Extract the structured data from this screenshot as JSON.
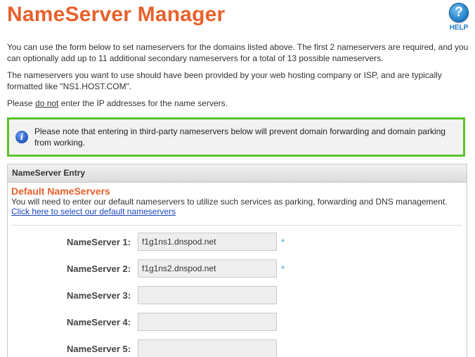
{
  "header": {
    "title": "NameServer Manager",
    "help_label": "HELP",
    "help_icon": "question-mark-icon"
  },
  "intro": {
    "paragraph1": "You can use the form below to set nameservers for the domains listed above. The first 2 nameservers are required, and you can optionally add up to 11 additional secondary nameservers for a total of 13 possible nameservers.",
    "paragraph2": "The nameservers you want to use should have been provided by your web hosting company or ISP, and are typically formatted like \"NS1.HOST.COM\".",
    "paragraph3_before": "Please ",
    "paragraph3_emphasis": "do not",
    "paragraph3_after": " enter the IP addresses for the name servers."
  },
  "notice": {
    "icon": "info-icon",
    "text": "Please note that entering in third-party nameservers below will prevent domain forwarding and domain parking from working."
  },
  "panel": {
    "header": "NameServer Entry",
    "section_title": "Default NameServers",
    "section_desc": "You will need to enter our default nameservers to utilize such services as parking, forwarding and DNS management.",
    "section_link": "Click here to select our default nameservers"
  },
  "nameservers": [
    {
      "label": "NameServer 1:",
      "value": "f1g1ns1.dnspod.net",
      "required_mark": "*"
    },
    {
      "label": "NameServer 2:",
      "value": "f1g1ns2.dnspod.net",
      "required_mark": "*"
    },
    {
      "label": "NameServer 3:",
      "value": "",
      "required_mark": ""
    },
    {
      "label": "NameServer 4:",
      "value": "",
      "required_mark": ""
    },
    {
      "label": "NameServer 5:",
      "value": "",
      "required_mark": ""
    }
  ],
  "colors": {
    "accent_orange": "#e8612c",
    "notice_border_green": "#5ac42b",
    "link_blue": "#1a44c2",
    "required_asterisk": "#3aa0d8"
  }
}
